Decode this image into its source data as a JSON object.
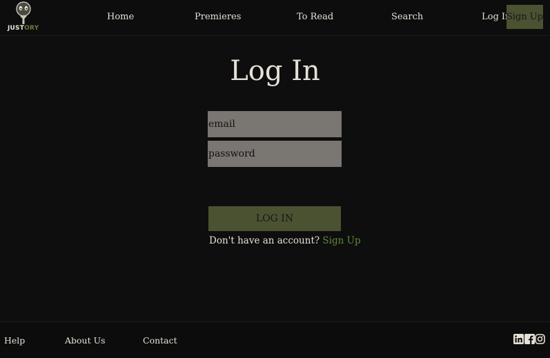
{
  "brand": {
    "name_part1": "JUST",
    "name_part2": "ORY"
  },
  "nav": {
    "items": [
      "Home",
      "Premieres",
      "To Read",
      "Search",
      "Log In"
    ],
    "signup_label": "Sign Up"
  },
  "login": {
    "title": "Log In",
    "email_placeholder": "email",
    "password_placeholder": "password",
    "submit_label": "LOG IN",
    "no_account_text": "Don't have an account?",
    "signup_link": "Sign Up"
  },
  "footer": {
    "links": [
      "Help",
      "About Us",
      "Contact"
    ],
    "social_icons": [
      "linkedin-icon",
      "facebook-icon",
      "instagram-icon"
    ]
  },
  "colors": {
    "background": "#0e0e0e",
    "accent_olive": "#4a5232",
    "link_green": "#5f8a3c",
    "field_gray": "#7a7671",
    "text": "#e6e1d6"
  }
}
